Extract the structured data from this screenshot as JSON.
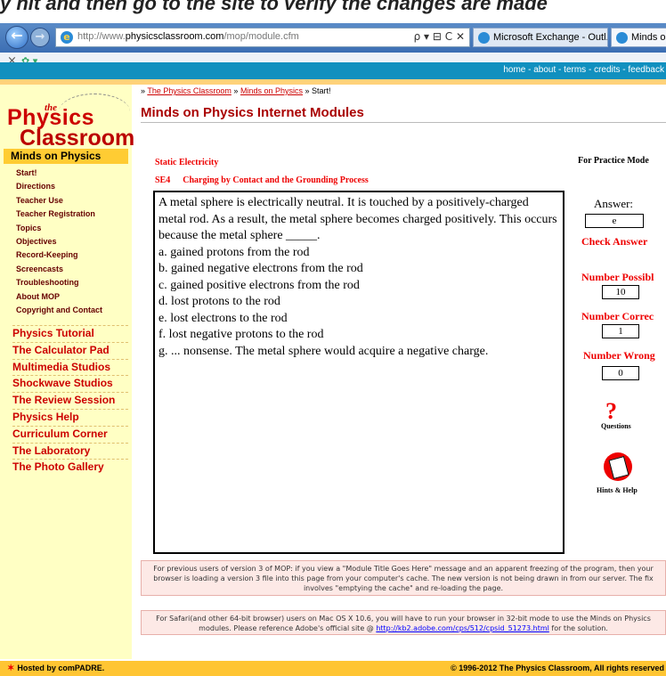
{
  "top_caption": "y hit and then go to the site to verify the changes are made",
  "browser": {
    "url_prefix": "http://www.",
    "url_domain": "physicsclassroom.com",
    "url_path": "/mop/module.cfm",
    "url_tools": "ρ ▾ ⊟ C ✕",
    "tabs": [
      "Microsoft Exchange - Outl...",
      "Minds on P"
    ]
  },
  "site_links": [
    "home",
    "about",
    "terms",
    "credits",
    "feedback"
  ],
  "logo": {
    "the": "the",
    "physics": "Physics",
    "classroom": "Classroom"
  },
  "sidebar": {
    "heading": "Minds on Physics",
    "items": [
      "Start!",
      "Directions",
      "Teacher Use",
      "Teacher Registration",
      "Topics",
      "Objectives",
      "Record-Keeping",
      "Screencasts",
      "Troubleshooting",
      "About MOP",
      "Copyright and Contact"
    ],
    "sections": [
      "Physics Tutorial",
      "The Calculator Pad",
      "Multimedia Studios",
      "Shockwave Studios",
      "The Review Session",
      "Physics Help",
      "Curriculum Corner",
      "The Laboratory",
      "The Photo Gallery"
    ]
  },
  "breadcrumb": {
    "sep": "»",
    "items": [
      "The Physics Classroom",
      "Minds on Physics"
    ],
    "current": "Start!"
  },
  "page_title": "Minds on Physics Internet Modules",
  "topic": "Static Electricity",
  "subtopic": {
    "code": "SE4",
    "title": "Charging by Contact and the Grounding Process"
  },
  "mode": "For Practice Mode",
  "question": {
    "stem": "A metal sphere is electrically neutral.  It is touched by a positively-charged metal rod.  As a result, the metal sphere becomes charged positively.  This occurs because the metal sphere _____.",
    "choices": [
      "a.  gained protons from the rod",
      "b.  gained negative electrons from the rod",
      "c.  gained positive electrons from the rod",
      "d.  lost protons to the rod",
      "e.  lost electrons to the rod",
      "f.  lost negative protons to the rod",
      "g.  ... nonsense.  The metal sphere would acquire a negative charge."
    ]
  },
  "answer": {
    "label": "Answer:",
    "value": "e",
    "check_label": "Check Answer"
  },
  "stats": {
    "possible_label": "Number Possibl",
    "possible_value": "10",
    "correct_label": "Number Correc",
    "correct_value": "1",
    "wrong_label": "Number Wrong",
    "wrong_value": "0"
  },
  "help": {
    "questions_caption": "Questions",
    "hints_caption": "Hints & Help"
  },
  "notes": {
    "note1": "For previous users of version 3 of MOP: if you view a \"Module Title Goes Here\" message and an apparent freezing of the program, then your browser is loading a version 3 file into this page from your computer's cache. The new version is not being drawn in from our server. The fix involves \"emptying the cache\" and re-loading the page.",
    "note2_text": "For Safari(and other 64-bit browser) users on Mac OS X 10.6, you will have to run your browser in 32-bit mode to use the Minds on Physics modules. Please reference Adobe's official site @",
    "note2_link": "http://kb2.adobe.com/cps/512/cpsid_51273.html",
    "note2_tail": "for the solution."
  },
  "footer": {
    "hosted": "Hosted by comPADRE.",
    "copyright": "© 1996-2012 The Physics Classroom, All rights reserved"
  }
}
